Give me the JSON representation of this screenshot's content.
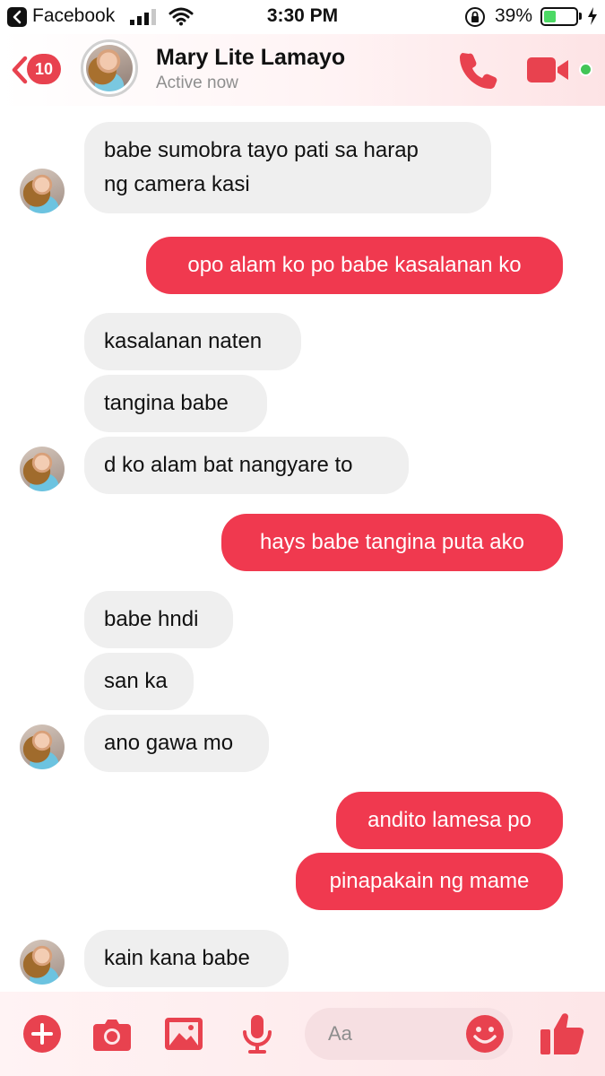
{
  "status_bar": {
    "back_app": "Facebook",
    "time": "3:30 PM",
    "battery_percent": "39%",
    "battery_level": 0.39,
    "icons": [
      "back-app-icon",
      "signal-icon",
      "wifi-icon",
      "orientation-lock-icon",
      "battery-icon",
      "charging-icon"
    ]
  },
  "header": {
    "back_badge_count": "10",
    "contact_name": "Mary Lite Lamayo",
    "contact_status": "Active now",
    "icons": [
      "back-chevron-icon",
      "phone-icon",
      "video-camera-icon",
      "online-indicator"
    ]
  },
  "messages": [
    {
      "dir": "in",
      "text_lines": [
        "babe sumobra tayo pati sa harap",
        "ng camera kasi"
      ],
      "show_avatar": true
    },
    {
      "dir": "out",
      "text": "opo alam ko po babe kasalanan ko"
    },
    {
      "dir": "in",
      "text": "kasalanan naten",
      "show_avatar": false
    },
    {
      "dir": "in",
      "text": "tangina babe",
      "show_avatar": false
    },
    {
      "dir": "in",
      "text": "d ko alam bat nangyare to",
      "show_avatar": true
    },
    {
      "dir": "out",
      "text": "hays babe tangina puta ako"
    },
    {
      "dir": "in",
      "text": "babe hndi",
      "show_avatar": false
    },
    {
      "dir": "in",
      "text": "san ka",
      "show_avatar": false
    },
    {
      "dir": "in",
      "text": "ano gawa mo",
      "show_avatar": true
    },
    {
      "dir": "out",
      "text": "andito lamesa po"
    },
    {
      "dir": "out",
      "text": "pinapakain ng mame"
    },
    {
      "dir": "in",
      "text": "kain kana babe",
      "show_avatar": true
    }
  ],
  "composer": {
    "placeholder": "Aa",
    "icons": [
      "plus-icon",
      "camera-icon",
      "gallery-icon",
      "microphone-icon",
      "emoji-icon",
      "thumbs-up-icon"
    ]
  },
  "colors": {
    "accent": "#f0394f",
    "incoming_bubble": "#efefef",
    "online": "#42c556",
    "battery": "#4cd964"
  }
}
